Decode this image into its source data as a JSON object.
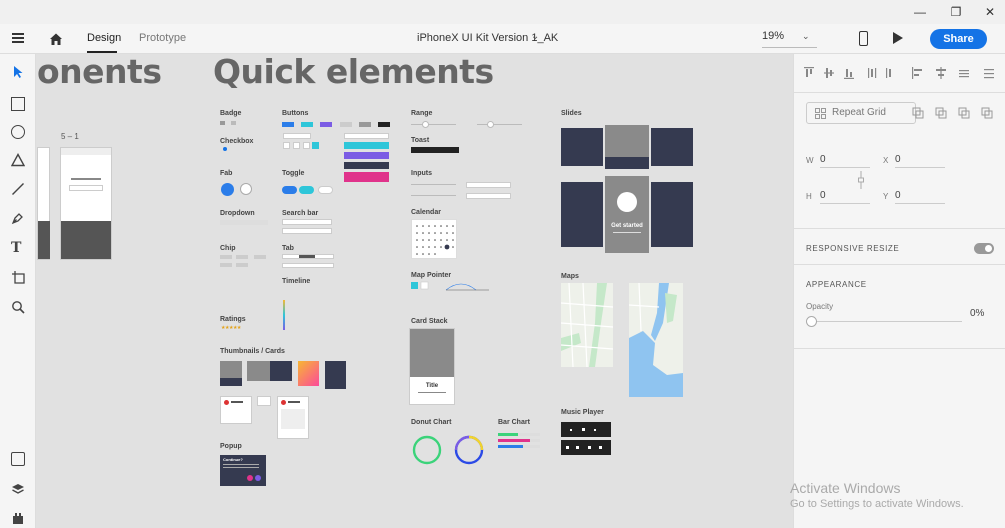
{
  "window": {
    "minimize": "—",
    "maximize": "❐",
    "close": "✕"
  },
  "toolbar": {
    "tab_design": "Design",
    "tab_prototype": "Prototype",
    "doc_title": "iPhoneX UI Kit Version 1_AK",
    "zoom": "19%",
    "share": "Share"
  },
  "canvas": {
    "title_components": "onents",
    "title_quick": "Quick elements",
    "artboard_label": "5 – 1",
    "sections": {
      "badge": "Badge",
      "checkbox": "Checkbox",
      "fab": "Fab",
      "dropdown": "Dropdown",
      "chip": "Chip",
      "ratings": "Ratings",
      "thumbnails": "Thumbnails / Cards",
      "popup": "Popup",
      "buttons": "Buttons",
      "toggle": "Toggle",
      "searchbar": "Search bar",
      "tab": "Tab",
      "timeline": "Timeline",
      "range": "Range",
      "toast": "Toast",
      "inputs": "Inputs",
      "calendar": "Calendar",
      "map_pointer": "Map Pointer",
      "card_stack": "Card Stack",
      "donut_chart": "Donut Chart",
      "bar_chart": "Bar Chart",
      "slides": "Slides",
      "maps": "Maps",
      "music_player": "Music Player"
    },
    "card_title": "Title",
    "slide_text": "Get started",
    "popup_title": "Continue?"
  },
  "panel": {
    "repeat_grid": "Repeat Grid",
    "w_label": "W",
    "w_value": "0",
    "h_label": "H",
    "h_value": "0",
    "x_label": "X",
    "x_value": "0",
    "y_label": "Y",
    "y_value": "0",
    "responsive_resize": "RESPONSIVE RESIZE",
    "appearance": "APPEARANCE",
    "opacity_label": "Opacity",
    "opacity_value": "0%"
  },
  "os": {
    "activate_title": "Activate Windows",
    "activate_sub": "Go to Settings to activate Windows."
  },
  "colors": {
    "accent": "#1473e6",
    "dark_card": "#353a50",
    "cyan": "#2ec6d9",
    "purple": "#7b5ce4",
    "pink": "#e0338b",
    "map_water": "#8fc4f0"
  }
}
